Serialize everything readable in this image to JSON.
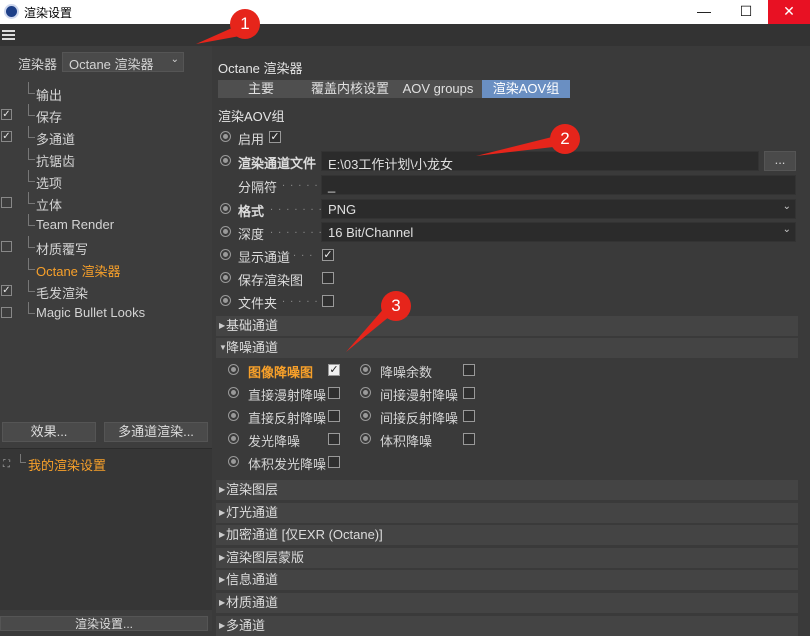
{
  "window": {
    "title": "渲染设置",
    "minimize": "—",
    "maximize": "☐",
    "close": "✕"
  },
  "left": {
    "renderer_label": "渲染器",
    "renderer_value": "Octane 渲染器",
    "tree": [
      {
        "label": "输出",
        "checked": false,
        "checkbox": false
      },
      {
        "label": "保存",
        "checked": true,
        "checkbox": true
      },
      {
        "label": "多通道",
        "checked": true,
        "checkbox": true
      },
      {
        "label": "抗锯齿",
        "checked": false,
        "checkbox": false
      },
      {
        "label": "选项",
        "checked": false,
        "checkbox": false
      },
      {
        "label": "立体",
        "checked": false,
        "checkbox": true
      },
      {
        "label": "Team Render",
        "checked": false,
        "checkbox": false
      },
      {
        "label": "材质覆写",
        "checked": false,
        "checkbox": true
      },
      {
        "label": "Octane 渲染器",
        "checked": false,
        "checkbox": false,
        "active": true
      },
      {
        "label": "毛发渲染",
        "checked": true,
        "checkbox": true
      },
      {
        "label": "Magic Bullet Looks",
        "checked": false,
        "checkbox": true
      }
    ],
    "effects_button": "效果...",
    "multipass_button": "多通道渲染...",
    "settings_item": "我的渲染设置",
    "render_settings_button": "渲染设置..."
  },
  "right": {
    "title": "Octane 渲染器",
    "tabs": [
      "主要",
      "覆盖内核设置",
      "AOV groups",
      "渲染AOV组"
    ],
    "active_tab": 3,
    "section": "渲染AOV组",
    "enable_label": "启用",
    "file_label": "渲染通道文件",
    "file_value": "E:\\03工作计划\\小龙女",
    "file_button": "...",
    "separator_label": "分隔符",
    "separator_value": "_",
    "format_label": "格式",
    "format_value": "PNG",
    "depth_label": "深度",
    "depth_value": "16 Bit/Channel",
    "show_label": "显示通道",
    "save_render_label": "保存渲染图",
    "folder_label": "文件夹",
    "groups_top": [
      "基础通道"
    ],
    "denoise_group": "降噪通道",
    "denoise_items": [
      {
        "label": "图像降噪图",
        "checked": true,
        "highlight": true
      },
      {
        "label": "降噪余数",
        "checked": false
      },
      {
        "label": "直接漫射降噪",
        "checked": false
      },
      {
        "label": "间接漫射降噪",
        "checked": false
      },
      {
        "label": "直接反射降噪",
        "checked": false
      },
      {
        "label": "间接反射降噪",
        "checked": false
      },
      {
        "label": "发光降噪",
        "checked": false
      },
      {
        "label": "体积降噪",
        "checked": false
      },
      {
        "label": "体积发光降噪",
        "checked": false
      }
    ],
    "groups_bottom": [
      "渲染图层",
      "灯光通道",
      "加密通道 [仅EXR (Octane)]",
      "渲染图层蒙版",
      "信息通道",
      "材质通道",
      "多通道"
    ]
  },
  "annotations": [
    "1",
    "2",
    "3"
  ],
  "colors": {
    "accent": "#f7a02a",
    "tab_active": "#6a8fc2",
    "close": "#e81123",
    "annotation": "#e6251b"
  }
}
